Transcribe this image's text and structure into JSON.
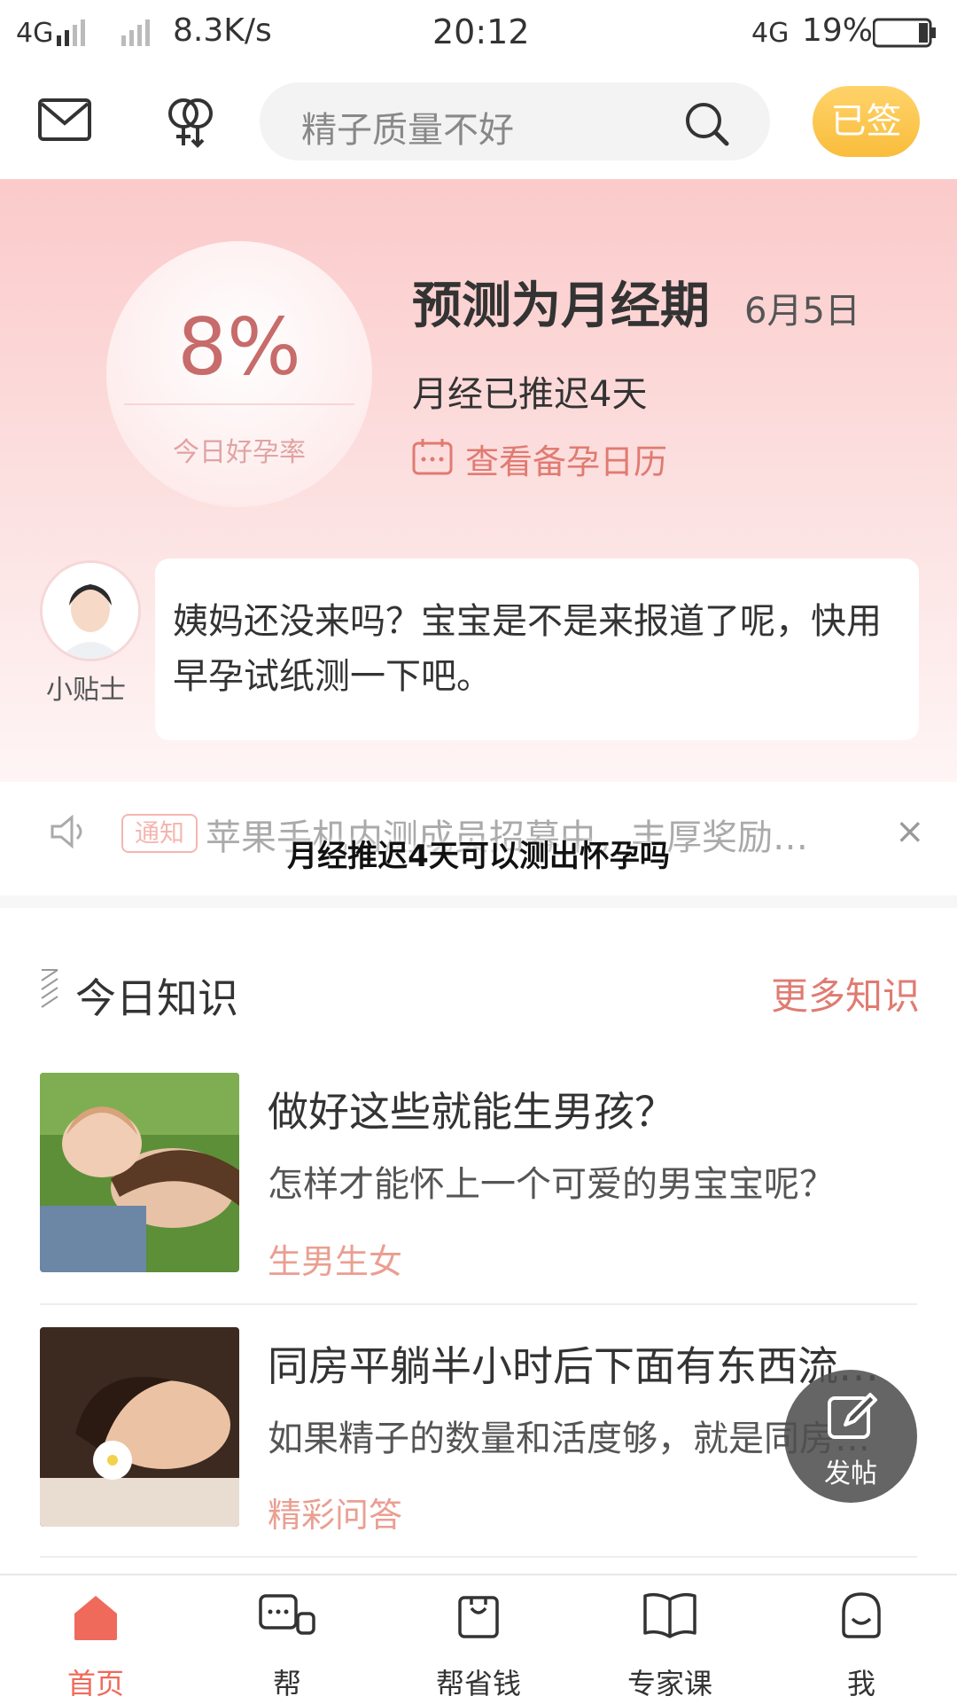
{
  "status_bar": {
    "network_left": "4G",
    "speed": "8.3K/s",
    "time": "20:12",
    "network_right": "4G",
    "battery": "19%"
  },
  "header": {
    "search_placeholder": "精子质量不好",
    "sign_label": "已签"
  },
  "prediction": {
    "rate": "8%",
    "rate_label": "今日好孕率",
    "title": "预测为月经期",
    "date": "6月5日",
    "delay_text": "月经已推迟4天",
    "calendar_link": "查看备孕日历"
  },
  "tip": {
    "author": "小贴士",
    "text": "姨妈还没来吗？宝宝是不是来报道了呢，快用早孕试纸测一下吧。"
  },
  "notice": {
    "tag": "通知",
    "text": "苹果手机内测成员招募中，丰厚奖励…",
    "close": "×"
  },
  "overlay_caption": "月经推迟4天可以测出怀孕吗",
  "knowledge": {
    "title": "今日知识",
    "more": "更多知识",
    "articles": [
      {
        "title": "做好这些就能生男孩？",
        "summary": "怎样才能怀上一个可爱的男宝宝呢？",
        "tag": "生男生女"
      },
      {
        "title": "同房平躺半小时后下面有东西流…",
        "summary": "如果精子的数量和活度够，就是同房…",
        "tag": "精彩问答"
      }
    ]
  },
  "fab": {
    "label": "发帖"
  },
  "nav": [
    {
      "label": "首页",
      "active": true
    },
    {
      "label": "帮"
    },
    {
      "label": "帮省钱"
    },
    {
      "label": "专家课"
    },
    {
      "label": "我"
    }
  ],
  "colors": {
    "accent": "#e07b72",
    "nav_active": "#ef6a5a",
    "sign_gold": "#f9bd3c"
  }
}
